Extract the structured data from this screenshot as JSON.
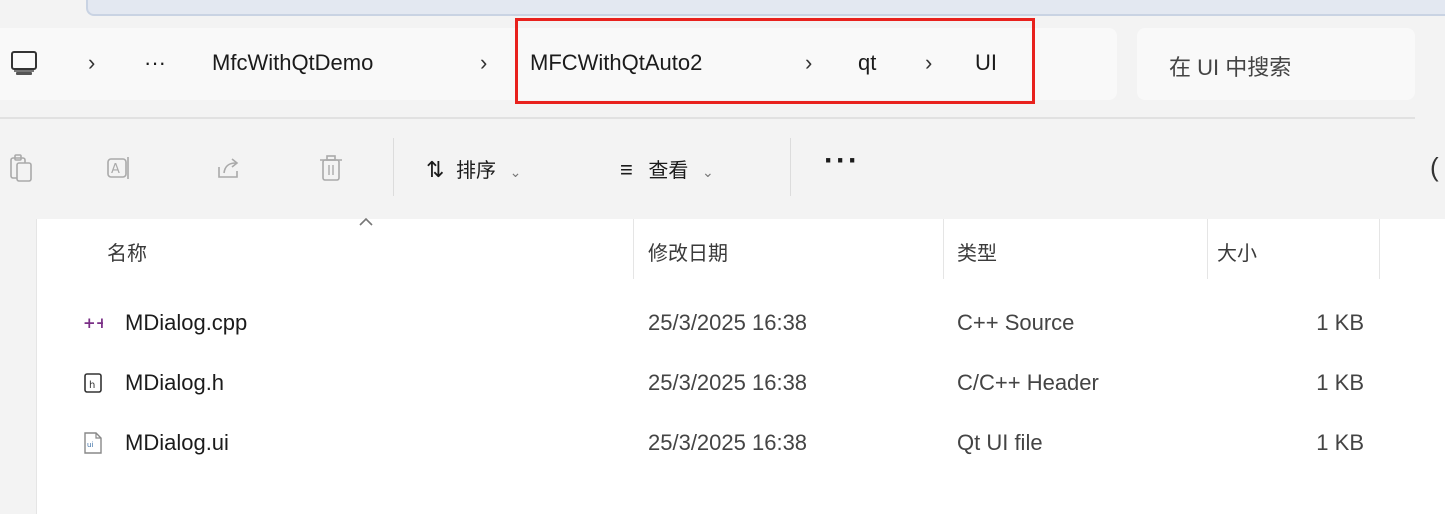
{
  "address_bar": {
    "crumbs": [
      "MfcWithQtDemo",
      "MFCWithQtAuto2",
      "qt",
      "UI"
    ],
    "overflow": "···",
    "separator": "›"
  },
  "search": {
    "placeholder": "在 UI 中搜索"
  },
  "toolbar": {
    "sort_label": "排序",
    "view_label": "查看",
    "more_label": "···"
  },
  "columns": {
    "name": "名称",
    "date": "修改日期",
    "type": "类型",
    "size": "大小"
  },
  "files": [
    {
      "name": "MDialog.cpp",
      "date": "25/3/2025 16:38",
      "type": "C++ Source",
      "size": "1 KB",
      "icon": "cpp-file-icon"
    },
    {
      "name": "MDialog.h",
      "date": "25/3/2025 16:38",
      "type": "C/C++ Header",
      "size": "1 KB",
      "icon": "header-file-icon"
    },
    {
      "name": "MDialog.ui",
      "date": "25/3/2025 16:38",
      "type": "Qt UI file",
      "size": "1 KB",
      "icon": "ui-file-icon"
    }
  ],
  "colors": {
    "highlight_box": "#e8211d",
    "cpp_icon": "#7a2f86"
  }
}
